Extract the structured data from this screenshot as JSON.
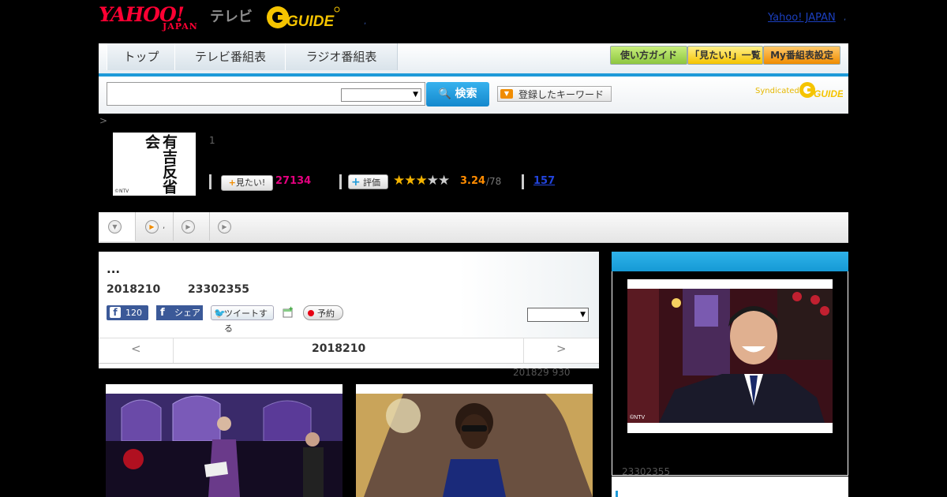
{
  "header": {
    "yahoo_logo": "YAHOO!",
    "yahoo_logo_sub": "JAPAN",
    "tv_label": "テレビ",
    "gguide_logo": "GUIDE",
    "link_text": "Yahoo! JAPAN",
    "dot": ","
  },
  "nav": {
    "tabs": [
      {
        "label": "トップ"
      },
      {
        "label": "テレビ番組表"
      },
      {
        "label": "ラジオ番組表"
      }
    ],
    "buttons": [
      {
        "label": "使い方ガイド"
      },
      {
        "label": "「見たい!」一覧"
      },
      {
        "label": "My番組表設定"
      }
    ]
  },
  "search": {
    "query": "",
    "select_value": "",
    "button_label": "検索",
    "keyword_button_label": "登録したキーワード",
    "syndicated_label": "Syndicated"
  },
  "breadcrumb": {
    "text": ">"
  },
  "program": {
    "image_text": "有吉反省会",
    "image_credit": "©NTV",
    "count": "1",
    "want_label": "見たい!",
    "want_count": "27134",
    "rate_label": "評価",
    "rating": "3.24",
    "rating_total": "/78",
    "stars_filled": 3,
    "stars_total": 5,
    "review_count": "157"
  },
  "tabs": [
    {
      "label": ""
    },
    {
      "label": ","
    },
    {
      "label": ""
    },
    {
      "label": ""
    }
  ],
  "main": {
    "title": "...",
    "date": "2018210",
    "time": "23302355",
    "fb_like_count": "120",
    "fb_share_label": "シェア",
    "tweet_label": "ツイートする",
    "reserve_label": "予約",
    "select_value": "",
    "date_nav": {
      "prev": "<",
      "current": "2018210",
      "next": ">"
    },
    "updated": "201829  930"
  },
  "sidebar": {
    "photo_credit": "©NTV",
    "time": "23302355"
  },
  "colors": {
    "accent": "#1e9ad8",
    "want_count": "#e4007f",
    "rating": "#ff8c00",
    "link": "#2244dd"
  }
}
